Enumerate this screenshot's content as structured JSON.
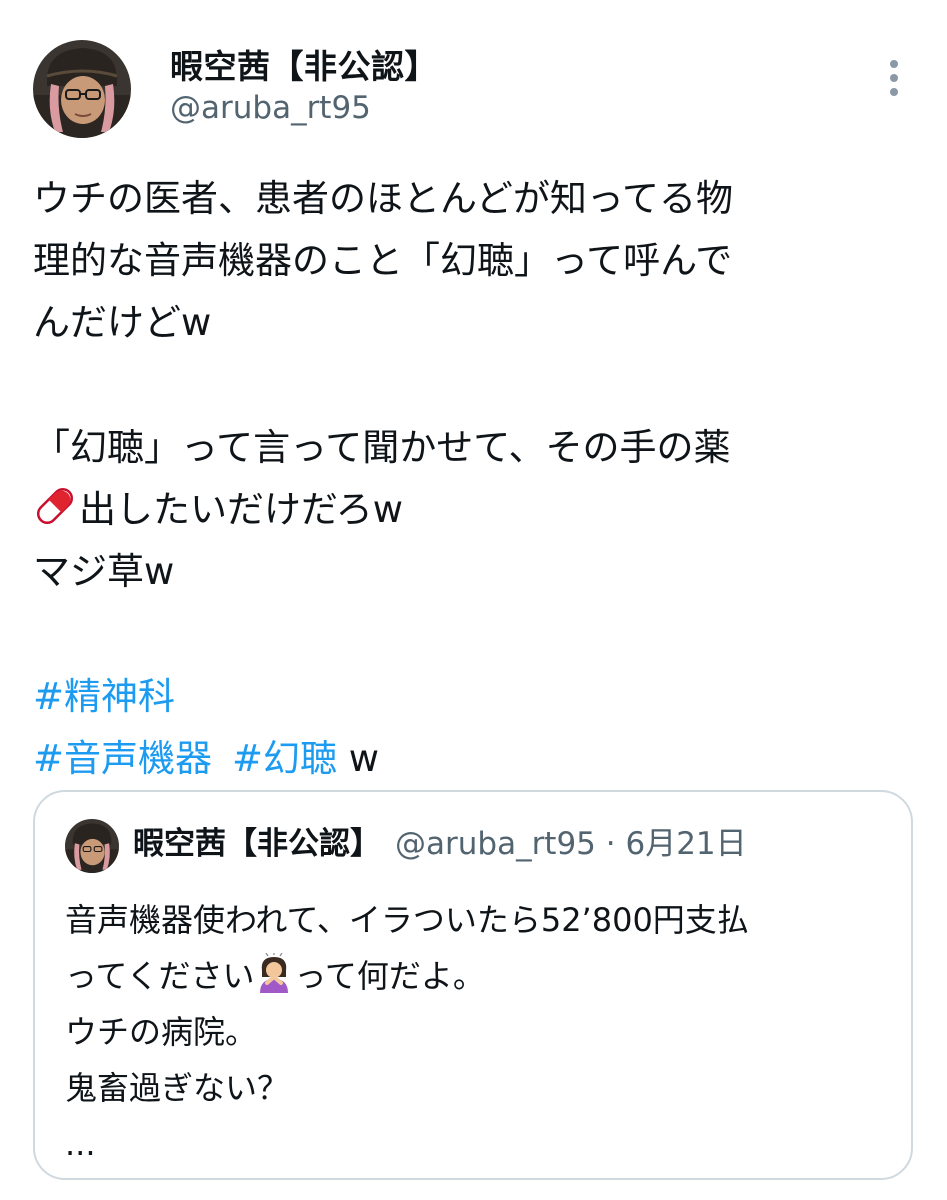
{
  "author": {
    "name": "暇空茜【非公認】",
    "handle": "@aruba_rt95"
  },
  "tweet": {
    "lines": [
      "ウチの医者、患者のほとんどが知ってる物",
      "理的な音声機器のこと「幻聴」って呼んで",
      "んだけどw",
      "「幻聴」って言って聞かせて、その手の薬",
      "出したいだけだろw",
      "マジ草w"
    ],
    "hashtags": [
      "#精神科",
      "#音声機器",
      "#幻聴"
    ],
    "hashtag_suffix": " w"
  },
  "quote": {
    "name": "暇空茜【非公認】",
    "meta": "@aruba_rt95 · 6月21日",
    "lines": [
      "音声機器使われて、イラついたら52’800円支払",
      "ってください",
      "って何だよ。",
      "ウチの病院。",
      "鬼畜過ぎない？",
      "..."
    ]
  },
  "icons": {
    "more": "more-vertical-icon",
    "pill": "pill-emoji",
    "person": "person-gesturing-ok-emoji"
  },
  "colors": {
    "link": "#1d9bf0",
    "secondary": "#536471",
    "border": "#cfd9de"
  }
}
